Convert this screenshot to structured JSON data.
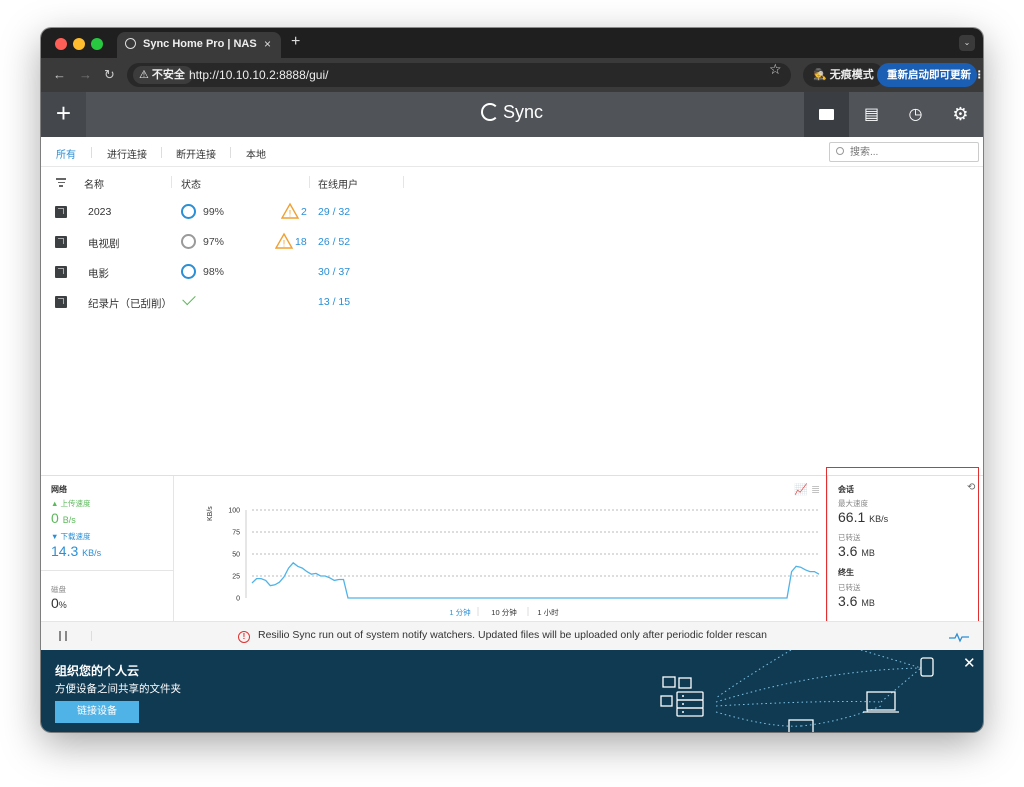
{
  "browser": {
    "tab_title": "Sync Home Pro | NAS",
    "tab_close": "×",
    "new_tab": "+",
    "tabbar_menu": "⌄",
    "insecure_label": "⚠ 不安全",
    "url": "http://10.10.10.2:8888/gui/",
    "incognito_label": "🕵 无痕模式",
    "update_label": "重新启动即可更新 ⋮"
  },
  "app": {
    "add_label": "+",
    "logo_text": "Sync"
  },
  "filters": {
    "all": "所有",
    "connecting": "进行连接",
    "disconnected": "断开连接",
    "local": "本地",
    "search_placeholder": "搜索..."
  },
  "columns": {
    "name": "名称",
    "status": "状态",
    "online_users": "在线用户"
  },
  "folders": [
    {
      "name": "2023",
      "status": "99%",
      "warning_count": "2",
      "peers": "29 / 32"
    },
    {
      "name": "电视剧",
      "status": "97%",
      "warning_count": "18",
      "peers": "26 / 52"
    },
    {
      "name": "电影",
      "status": "98%",
      "warning_count": "",
      "peers": "30 / 37"
    },
    {
      "name": "纪录片（已刮削）",
      "status": "",
      "warning_count": "",
      "peers": "13 / 15"
    }
  ],
  "network": {
    "title": "网络",
    "upload_label": "▲ 上传速度",
    "upload_value": "0",
    "upload_unit": "B/s",
    "download_label": "▼ 下载速度",
    "download_value": "14.3",
    "download_unit": "KB/s"
  },
  "disk": {
    "title": "磁盘",
    "value": "0",
    "unit": "%"
  },
  "graph": {
    "unit": "KB/s",
    "range_1m": "1 分钟",
    "range_10m": "10 分钟",
    "range_1h": "1 小时"
  },
  "session": {
    "title": "会话",
    "max_speed_label": "最大速度",
    "max_speed_value": "66.1",
    "max_speed_unit": "KB/s",
    "transferred_label": "已转送",
    "transferred_value": "3.6",
    "transferred_unit": "MB"
  },
  "lifetime": {
    "title": "终生",
    "transferred_label": "已转送",
    "transferred_value": "3.6",
    "transferred_unit": "MB"
  },
  "status_message": "Resilio Sync run out of system notify watchers. Updated files will be uploaded only after periodic folder rescan",
  "banner": {
    "title": "组织您的个人云",
    "subtitle": "方便设备之间共享的文件夹",
    "button": "链接设备",
    "close": "✕"
  },
  "chart_data": {
    "type": "line",
    "title": "",
    "xlabel": "",
    "ylabel": "KB/s",
    "ylim": [
      0,
      100
    ],
    "yticks": [
      0,
      25,
      50,
      75,
      100
    ],
    "y": [
      17,
      22,
      22,
      20,
      14,
      15,
      18,
      24,
      34,
      40,
      36,
      34,
      30,
      27,
      28,
      25,
      25,
      23,
      20,
      21,
      21,
      0,
      0,
      0,
      0,
      0,
      0,
      0,
      0,
      0,
      0,
      0,
      0,
      0,
      0,
      0,
      0,
      0,
      0,
      0,
      0,
      0,
      0,
      0,
      0,
      0,
      0,
      0,
      0,
      0,
      0,
      0,
      0,
      0,
      0,
      0,
      0,
      0,
      0,
      0,
      0,
      0,
      0,
      0,
      0,
      0,
      0,
      0,
      0,
      0,
      0,
      0,
      0,
      0,
      0,
      0,
      0,
      0,
      0,
      0,
      0,
      0,
      0,
      0,
      0,
      0,
      0,
      0,
      0,
      0,
      0,
      0,
      0,
      0,
      0,
      0,
      0,
      0,
      0,
      0,
      0,
      0,
      0,
      0,
      0,
      0,
      0,
      0,
      0,
      0,
      0,
      0,
      0,
      0,
      0,
      0,
      0,
      0,
      30,
      36,
      35,
      32,
      30,
      30,
      27
    ],
    "grid": true,
    "colors": {
      "line": "#4fb3e8"
    }
  }
}
